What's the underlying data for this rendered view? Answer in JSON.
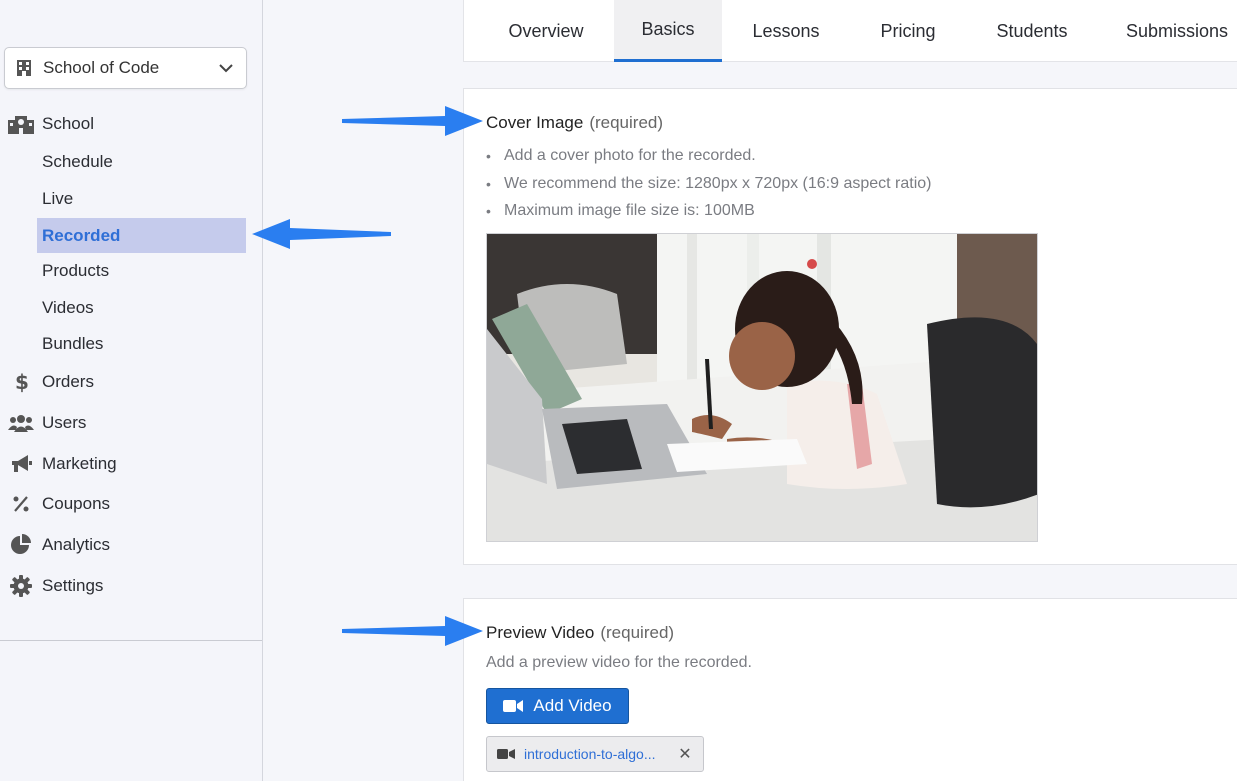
{
  "sidebar": {
    "school_selector": "School of Code",
    "sections": {
      "school": "School",
      "orders": "Orders",
      "users": "Users",
      "marketing": "Marketing",
      "coupons": "Coupons",
      "analytics": "Analytics",
      "settings": "Settings"
    },
    "school_items": [
      "Schedule",
      "Live",
      "Recorded",
      "Products",
      "Videos",
      "Bundles"
    ],
    "active_item": "Recorded"
  },
  "tabs": [
    "Overview",
    "Basics",
    "Lessons",
    "Pricing",
    "Students",
    "Submissions"
  ],
  "active_tab": "Basics",
  "cover": {
    "title": "Cover Image",
    "required": "(required)",
    "bullets": [
      "Add a cover photo for the recorded.",
      "We recommend the size: 1280px x 720px (16:9 aspect ratio)",
      "Maximum image file size is: 100MB"
    ]
  },
  "video": {
    "title": "Preview Video",
    "required": "(required)",
    "description": "Add a preview video for the recorded.",
    "add_button": "Add Video",
    "file_name": "introduction-to-algo..."
  },
  "colors": {
    "accent": "#1f6fd1",
    "active_bg": "#c5cbec",
    "annotation_arrow": "#2a7ef0"
  },
  "icons": {
    "school_selector": "building-icon",
    "school": "school-icon",
    "orders": "dollar-icon",
    "users": "users-icon",
    "marketing": "megaphone-icon",
    "coupons": "percent-icon",
    "analytics": "pie-chart-icon",
    "settings": "gear-icon",
    "add_video": "video-camera-icon"
  }
}
